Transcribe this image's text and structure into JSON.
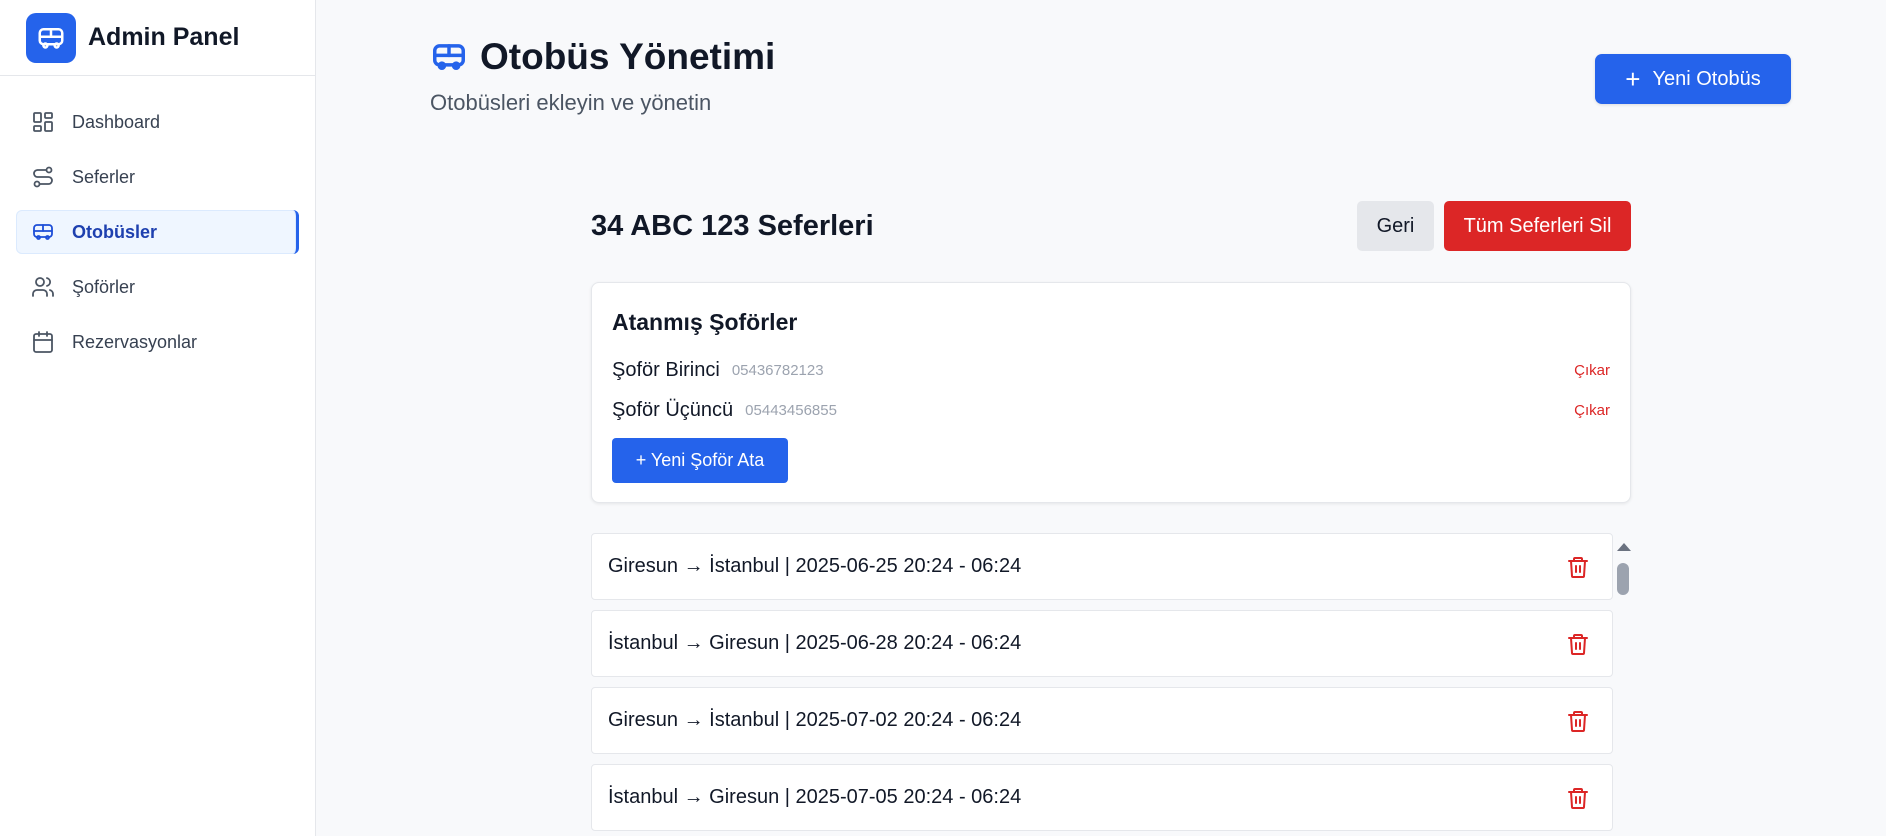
{
  "sidebar": {
    "brand": "Admin Panel",
    "items": [
      {
        "label": "Dashboard",
        "icon": "dashboard-icon",
        "active": false
      },
      {
        "label": "Seferler",
        "icon": "route-icon",
        "active": false
      },
      {
        "label": "Otobüsler",
        "icon": "bus-icon",
        "active": true
      },
      {
        "label": "Şoförler",
        "icon": "users-icon",
        "active": false
      },
      {
        "label": "Rezervasyonlar",
        "icon": "calendar-icon",
        "active": false
      }
    ]
  },
  "header": {
    "title": "Otobüs Yönetimi",
    "subtitle": "Otobüsleri ekleyin ve yönetin",
    "new_bus_label": "Yeni Otobüs"
  },
  "trips_panel": {
    "title": "34 ABC 123 Seferleri",
    "back_label": "Geri",
    "delete_all_label": "Tüm Seferleri Sil"
  },
  "drivers": {
    "title": "Atanmış Şoförler",
    "list": [
      {
        "name": "Şoför Birinci",
        "phone": "05436782123",
        "remove_label": "Çıkar"
      },
      {
        "name": "Şoför Üçüncü",
        "phone": "05443456855",
        "remove_label": "Çıkar"
      }
    ],
    "assign_label": "+ Yeni Şoför Ata"
  },
  "trips": [
    "Giresun → İstanbul | 2025-06-25 20:24 - 06:24",
    "İstanbul → Giresun | 2025-06-28 20:24 - 06:24",
    "Giresun → İstanbul | 2025-07-02 20:24 - 06:24",
    "İstanbul → Giresun | 2025-07-05 20:24 - 06:24"
  ],
  "colors": {
    "primary": "#2563eb",
    "danger": "#dc2626",
    "active_bg": "#eff6ff",
    "active_text": "#1e40af"
  }
}
